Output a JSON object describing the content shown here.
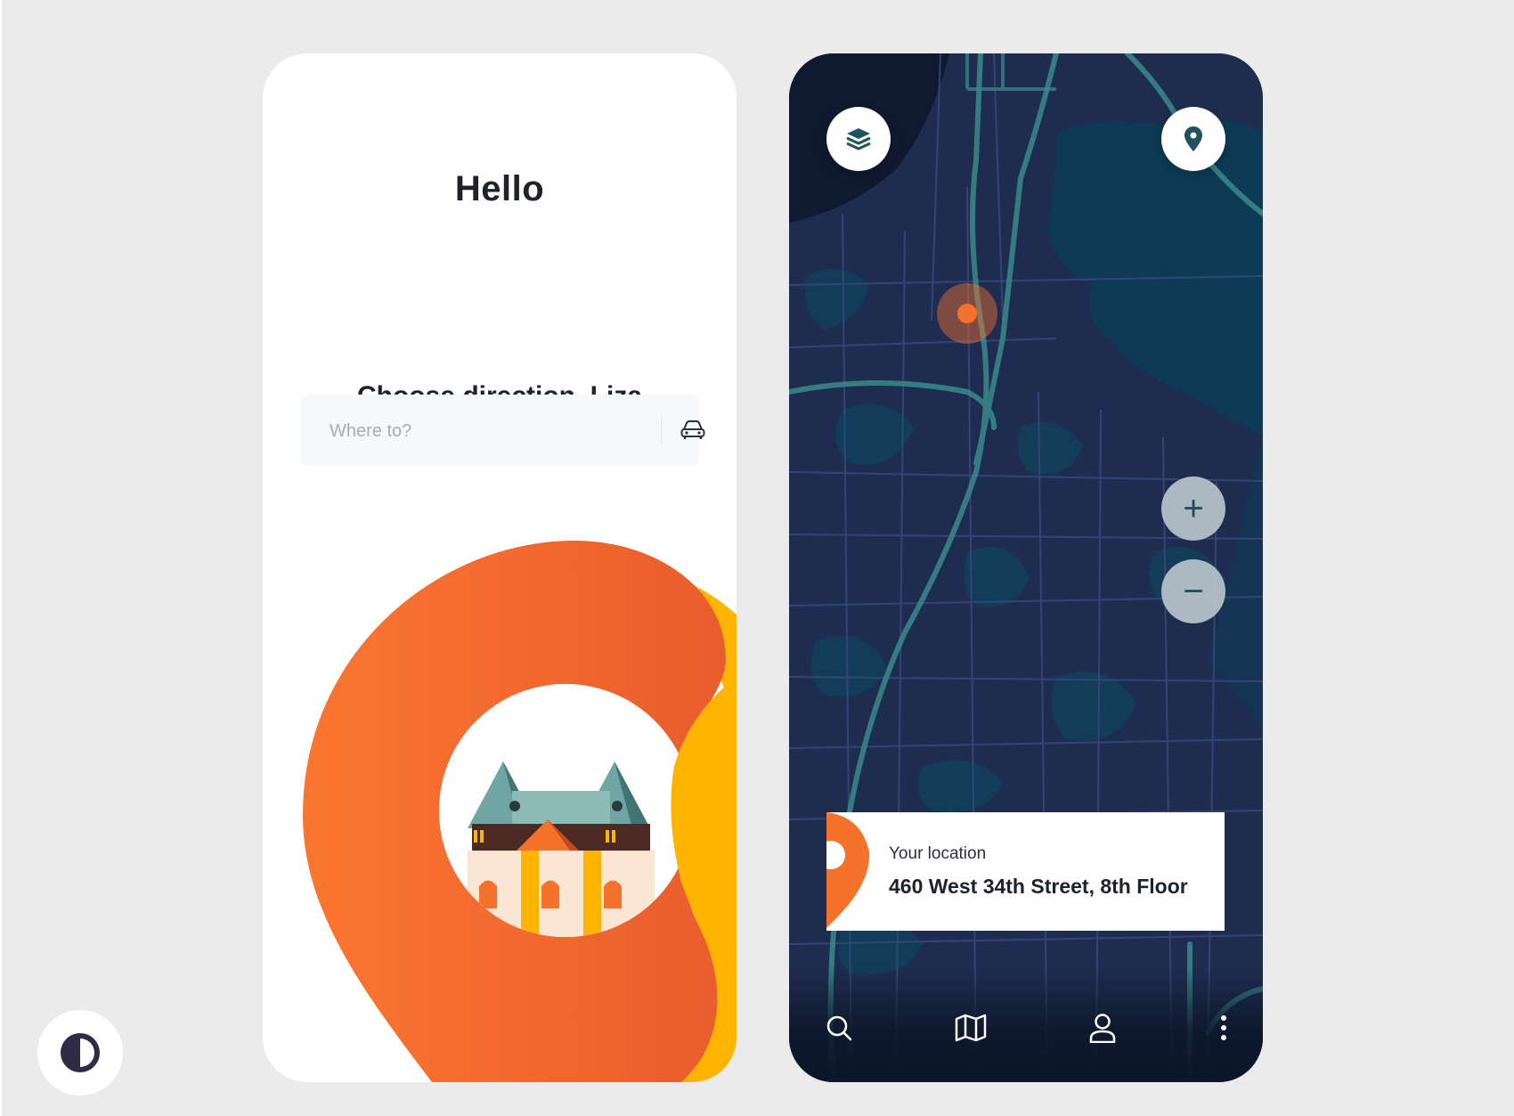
{
  "welcome": {
    "greeting": "Hello",
    "subtitle": "Choose direction, Liza",
    "search": {
      "placeholder": "Where to?",
      "value": ""
    },
    "car_icon": "car-icon"
  },
  "map": {
    "layers_icon": "layers-icon",
    "location_pin_icon": "location-pin-icon",
    "zoom_in_label": "+",
    "zoom_out_label": "−",
    "location_card": {
      "label": "Your location",
      "address": "460 West 34th Street, 8th Floor"
    },
    "nav": [
      {
        "icon": "search-icon"
      },
      {
        "icon": "map-icon"
      },
      {
        "icon": "user-icon"
      },
      {
        "icon": "more-icon"
      }
    ]
  },
  "theme_toggle_icon": "contrast-icon",
  "colors": {
    "accent_orange": "#f5722c",
    "accent_yellow": "#ffb400",
    "map_background": "#1d2b4e",
    "map_road": "#3a8b8b",
    "map_water": "#0d3a55"
  }
}
